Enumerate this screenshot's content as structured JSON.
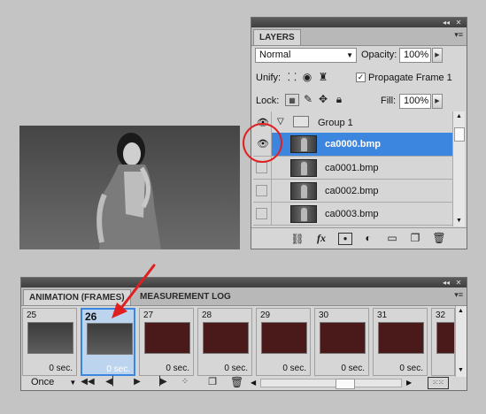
{
  "layers_panel": {
    "title": "LAYERS",
    "blend_mode": "Normal",
    "opacity_label": "Opacity:",
    "opacity_value": "100%",
    "unify_label": "Unify:",
    "propagate_label": "Propagate Frame 1",
    "propagate_checked": true,
    "lock_label": "Lock:",
    "fill_label": "Fill:",
    "fill_value": "100%",
    "group_name": "Group 1",
    "layers": [
      {
        "name": "ca0000.bmp",
        "visible": true,
        "selected": true
      },
      {
        "name": "ca0001.bmp",
        "visible": false,
        "selected": false
      },
      {
        "name": "ca0002.bmp",
        "visible": false,
        "selected": false
      },
      {
        "name": "ca0003.bmp",
        "visible": false,
        "selected": false
      }
    ],
    "footer_icons": [
      "link-icon",
      "fx-icon",
      "mask-icon",
      "adjustment-icon",
      "folder-icon",
      "new-layer-icon",
      "trash-icon"
    ]
  },
  "animation_panel": {
    "tabs": [
      {
        "label": "ANIMATION (FRAMES)",
        "active": true
      },
      {
        "label": "MEASUREMENT LOG",
        "active": false
      }
    ],
    "frames": [
      {
        "num": "25",
        "delay": "0 sec.",
        "thumb": "girl",
        "selected": false
      },
      {
        "num": "26",
        "delay": "0 sec.",
        "thumb": "girl",
        "selected": true
      },
      {
        "num": "27",
        "delay": "0 sec.",
        "thumb": "red",
        "selected": false
      },
      {
        "num": "28",
        "delay": "0 sec.",
        "thumb": "red",
        "selected": false
      },
      {
        "num": "29",
        "delay": "0 sec.",
        "thumb": "red",
        "selected": false
      },
      {
        "num": "30",
        "delay": "0 sec.",
        "thumb": "red",
        "selected": false
      },
      {
        "num": "31",
        "delay": "0 sec.",
        "thumb": "red",
        "selected": false
      },
      {
        "num": "32",
        "delay": "",
        "thumb": "red",
        "selected": false
      }
    ],
    "loop": "Once"
  },
  "colors": {
    "selection": "#3d86e0",
    "annotation": "#e02020"
  }
}
